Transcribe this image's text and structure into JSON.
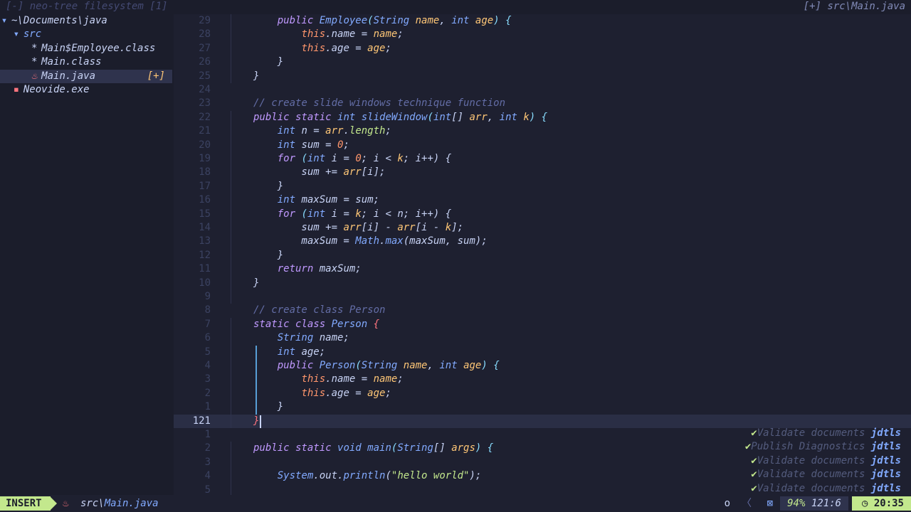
{
  "tree": {
    "title": "[-] neo-tree filesystem [1]",
    "items": [
      {
        "indent": "",
        "icon": "▾",
        "iconColor": "#82aaff",
        "label": "~\\Documents\\java",
        "color": "#c8d3f5",
        "mod": ""
      },
      {
        "indent": "  ",
        "icon": "▾",
        "iconColor": "#82aaff",
        "label": "src",
        "color": "#82aaff",
        "mod": ""
      },
      {
        "indent": "     ",
        "icon": "*",
        "iconColor": "#c8d3f5",
        "label": "Main$Employee.class",
        "color": "#c8d3f5",
        "mod": ""
      },
      {
        "indent": "     ",
        "icon": "*",
        "iconColor": "#c8d3f5",
        "label": "Main.class",
        "color": "#c8d3f5",
        "mod": ""
      },
      {
        "indent": "     ",
        "icon": "♨",
        "iconColor": "#ff757f",
        "label": "Main.java",
        "color": "#c8d3f5",
        "mod": "[+]"
      },
      {
        "indent": "  ",
        "icon": "▪",
        "iconColor": "#ff757f",
        "label": "Neovide.exe",
        "color": "#c8d3f5",
        "mod": ""
      }
    ]
  },
  "editor": {
    "title": "[+] src\\Main.java",
    "current_line": "121",
    "lines": [
      {
        "n": "29",
        "t": [
          [
            "    ",
            ""
          ],
          [
            "public ",
            "kw"
          ],
          [
            "Employee",
            "fn"
          ],
          [
            "(",
            "op"
          ],
          [
            "String ",
            "ty"
          ],
          [
            "name",
            "pa"
          ],
          [
            ", ",
            ""
          ],
          [
            "int ",
            "ty"
          ],
          [
            "age",
            "pa"
          ],
          [
            ") {",
            "op"
          ]
        ]
      },
      {
        "n": "28",
        "t": [
          [
            "        ",
            ""
          ],
          [
            "this",
            "th"
          ],
          [
            ".name = ",
            ""
          ],
          [
            "name",
            "pa"
          ],
          [
            ";",
            ""
          ]
        ]
      },
      {
        "n": "27",
        "t": [
          [
            "        ",
            ""
          ],
          [
            "this",
            "th"
          ],
          [
            ".age = ",
            ""
          ],
          [
            "age",
            "pa"
          ],
          [
            ";",
            ""
          ]
        ]
      },
      {
        "n": "26",
        "t": [
          [
            "    }",
            ""
          ]
        ]
      },
      {
        "n": "25",
        "t": [
          [
            "}",
            ""
          ]
        ]
      },
      {
        "n": "24",
        "t": [
          [
            "",
            ""
          ]
        ]
      },
      {
        "n": "23",
        "t": [
          [
            "// create slide windows technique function",
            "cm"
          ]
        ]
      },
      {
        "n": "22",
        "t": [
          [
            "public static ",
            "kw"
          ],
          [
            "int ",
            "ty"
          ],
          [
            "slideWindow",
            "fn"
          ],
          [
            "(",
            "op"
          ],
          [
            "int",
            "ty"
          ],
          [
            "[] ",
            ""
          ],
          [
            "arr",
            "pa"
          ],
          [
            ", ",
            ""
          ],
          [
            "int ",
            "ty"
          ],
          [
            "k",
            "pa"
          ],
          [
            ") {",
            "op"
          ]
        ]
      },
      {
        "n": "21",
        "t": [
          [
            "    ",
            ""
          ],
          [
            "int ",
            "ty"
          ],
          [
            "n = ",
            ""
          ],
          [
            "arr",
            "pa"
          ],
          [
            ".",
            ""
          ],
          [
            "length",
            "st"
          ],
          [
            ";",
            ""
          ]
        ]
      },
      {
        "n": "20",
        "t": [
          [
            "    ",
            ""
          ],
          [
            "int ",
            "ty"
          ],
          [
            "sum = ",
            ""
          ],
          [
            "0",
            "nu"
          ],
          [
            ";",
            ""
          ]
        ]
      },
      {
        "n": "19",
        "t": [
          [
            "    ",
            ""
          ],
          [
            "for ",
            "kw"
          ],
          [
            "(",
            "op"
          ],
          [
            "int ",
            "ty"
          ],
          [
            "i = ",
            ""
          ],
          [
            "0",
            "nu"
          ],
          [
            "; i < ",
            ""
          ],
          [
            "k",
            "pa"
          ],
          [
            "; i++) {",
            ""
          ]
        ]
      },
      {
        "n": "18",
        "t": [
          [
            "        sum += ",
            ""
          ],
          [
            "arr",
            "pa"
          ],
          [
            "[i];",
            ""
          ]
        ]
      },
      {
        "n": "17",
        "t": [
          [
            "    }",
            ""
          ]
        ]
      },
      {
        "n": "16",
        "t": [
          [
            "    ",
            ""
          ],
          [
            "int ",
            "ty"
          ],
          [
            "maxSum = sum;",
            ""
          ]
        ]
      },
      {
        "n": "15",
        "t": [
          [
            "    ",
            ""
          ],
          [
            "for ",
            "kw"
          ],
          [
            "(",
            "op"
          ],
          [
            "int ",
            "ty"
          ],
          [
            "i = ",
            ""
          ],
          [
            "k",
            "pa"
          ],
          [
            "; i < n; i++) {",
            ""
          ]
        ]
      },
      {
        "n": "14",
        "t": [
          [
            "        sum += ",
            ""
          ],
          [
            "arr",
            "pa"
          ],
          [
            "[i] - ",
            ""
          ],
          [
            "arr",
            "pa"
          ],
          [
            "[i - ",
            ""
          ],
          [
            "k",
            "pa"
          ],
          [
            "];",
            ""
          ]
        ]
      },
      {
        "n": "13",
        "t": [
          [
            "        maxSum = ",
            ""
          ],
          [
            "Math",
            "ty"
          ],
          [
            ".",
            ""
          ],
          [
            "max",
            "fn"
          ],
          [
            "(maxSum, sum);",
            ""
          ]
        ]
      },
      {
        "n": "12",
        "t": [
          [
            "    }",
            ""
          ]
        ]
      },
      {
        "n": "11",
        "t": [
          [
            "    ",
            ""
          ],
          [
            "return ",
            "kw"
          ],
          [
            "maxSum;",
            ""
          ]
        ]
      },
      {
        "n": "10",
        "t": [
          [
            "}",
            ""
          ]
        ]
      },
      {
        "n": "9",
        "t": [
          [
            "",
            ""
          ]
        ]
      },
      {
        "n": "8",
        "t": [
          [
            "// create class Person",
            "cm"
          ]
        ]
      },
      {
        "n": "7",
        "t": [
          [
            "static class ",
            "kw"
          ],
          [
            "Person ",
            "fn"
          ],
          [
            "{",
            "br"
          ]
        ]
      },
      {
        "n": "6",
        "t": [
          [
            "    ",
            ""
          ],
          [
            "String ",
            "ty"
          ],
          [
            "name;",
            ""
          ]
        ]
      },
      {
        "n": "5",
        "t": [
          [
            "    ",
            ""
          ],
          [
            "int ",
            "ty"
          ],
          [
            "age;",
            ""
          ]
        ]
      },
      {
        "n": "4",
        "t": [
          [
            "    ",
            ""
          ],
          [
            "public ",
            "kw"
          ],
          [
            "Person",
            "fn"
          ],
          [
            "(",
            "op"
          ],
          [
            "String ",
            "ty"
          ],
          [
            "name",
            "pa"
          ],
          [
            ", ",
            ""
          ],
          [
            "int ",
            "ty"
          ],
          [
            "age",
            "pa"
          ],
          [
            ") {",
            "op"
          ]
        ]
      },
      {
        "n": "3",
        "t": [
          [
            "        ",
            ""
          ],
          [
            "this",
            "th"
          ],
          [
            ".name = ",
            ""
          ],
          [
            "name",
            "pa"
          ],
          [
            ";",
            ""
          ]
        ]
      },
      {
        "n": "2",
        "t": [
          [
            "        ",
            ""
          ],
          [
            "this",
            "th"
          ],
          [
            ".age = ",
            ""
          ],
          [
            "age",
            "pa"
          ],
          [
            ";",
            ""
          ]
        ]
      },
      {
        "n": "1",
        "t": [
          [
            "    }",
            ""
          ]
        ]
      },
      {
        "n": "121",
        "t": [
          [
            "}",
            "br"
          ]
        ]
      },
      {
        "n": "1",
        "t": [
          [
            "",
            ""
          ]
        ]
      },
      {
        "n": "2",
        "t": [
          [
            "public static ",
            "kw"
          ],
          [
            "void ",
            "ty"
          ],
          [
            "main",
            "fn"
          ],
          [
            "(",
            "op"
          ],
          [
            "String",
            "ty"
          ],
          [
            "[] ",
            ""
          ],
          [
            "args",
            "pa"
          ],
          [
            ") {",
            "op"
          ]
        ]
      },
      {
        "n": "3",
        "t": [
          [
            "",
            ""
          ]
        ]
      },
      {
        "n": "4",
        "t": [
          [
            "    ",
            ""
          ],
          [
            "System",
            "ty"
          ],
          [
            ".out.",
            ""
          ],
          [
            "println",
            "fn"
          ],
          [
            "(",
            ""
          ],
          [
            "\"hello world\"",
            "st"
          ],
          [
            ");",
            ""
          ]
        ]
      },
      {
        "n": "5",
        "t": [
          [
            "",
            ""
          ]
        ]
      }
    ]
  },
  "notifications": [
    {
      "msg": "Validate documents",
      "src": "jdtls"
    },
    {
      "msg": "Publish Diagnostics",
      "src": "jdtls"
    },
    {
      "msg": "Validate documents",
      "src": "jdtls"
    },
    {
      "msg": "Validate documents",
      "src": "jdtls"
    },
    {
      "msg": "Validate documents",
      "src": "jdtls"
    }
  ],
  "status": {
    "mode": "INSERT",
    "file_prefix": "src\\",
    "file_name": "Main.java",
    "ff_indicator": "o",
    "progress": "94%",
    "position": "121:6",
    "time": "20:35"
  }
}
